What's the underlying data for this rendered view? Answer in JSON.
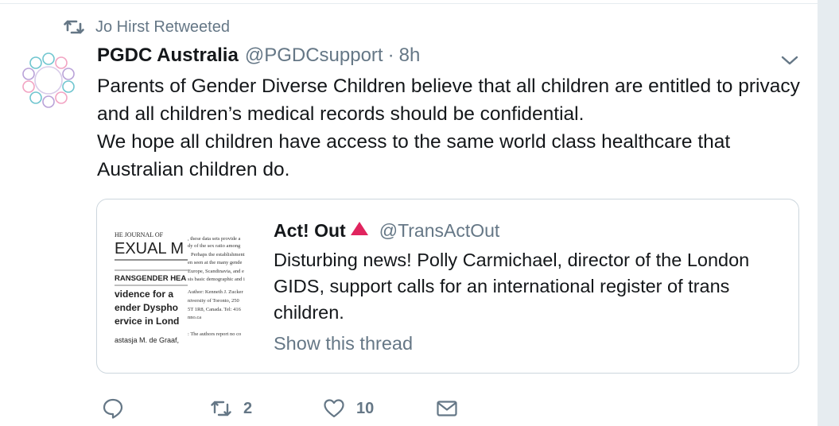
{
  "retweet": {
    "text": "Jo Hirst Retweeted",
    "icon": "retweet-icon"
  },
  "tweet": {
    "name": "PGDC Australia",
    "handle": "@PGDCsupport",
    "separator": "·",
    "time": "8h",
    "lines": [
      "Parents of Gender Diverse Children believe that all children are entitled to privacy",
      "and all children’s medical records should be confidential.",
      "We hope all children have access to the same world class healthcare that",
      "Australian children do."
    ]
  },
  "quote": {
    "name": "Act! Out",
    "handle": "@TransActOut",
    "lines": [
      "Disturbing news! Polly Carmichael, director of the London",
      "GIDS, support calls for an international register of trans",
      "children."
    ],
    "show_thread": "Show this thread",
    "thumbnail": {
      "journal": "HE JOURNAL OF",
      "journal_big": "EXUAL M",
      "section": "RANSGENDER HEA",
      "title_lines": [
        "vidence for a",
        "ender Dyspho",
        "ervice in Lond"
      ],
      "authors": "astasja M. de Graaf,",
      "col_lines": [
        ", these data sets provide a",
        "dy of the sex ratio among",
        "Perhaps the establishment",
        "en seen at the many gende",
        "Europe, Scandinavia, and e",
        "sis basic demographic and i",
        "Author: Kenneth J. Zucker",
        "niversity of Toronto, 250",
        "5T 1R8, Canada. Tel: 416",
        "nno.ca",
        ": The authors report no co"
      ]
    }
  },
  "actions": {
    "reply": {
      "icon": "reply-icon",
      "count": ""
    },
    "retweet": {
      "icon": "retweet-icon",
      "count": "2"
    },
    "like": {
      "icon": "heart-icon",
      "count": "10"
    },
    "message": {
      "icon": "envelope-icon",
      "count": ""
    }
  },
  "colors": {
    "text": "#14171a",
    "secondary": "#657786",
    "border": "#ccd6dd",
    "accent_red": "#e0245e"
  }
}
